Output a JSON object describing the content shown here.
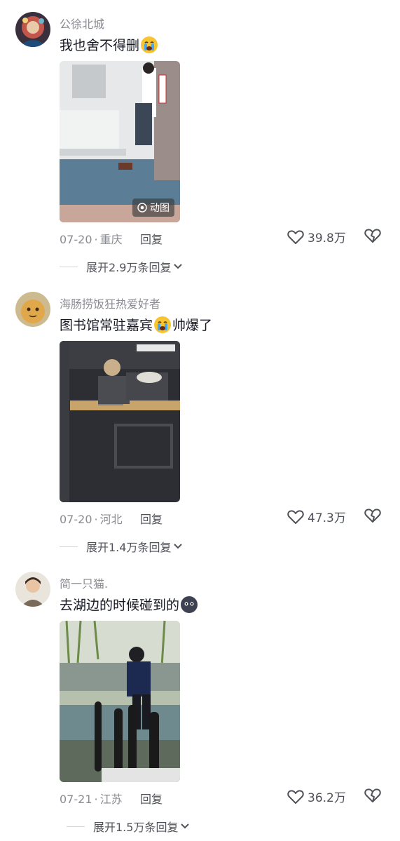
{
  "comments": [
    {
      "username": "公徐北城",
      "text_before": "我也舍不得删",
      "emoji": "crying-face-emoji",
      "text_after": "",
      "photo_badge": "动图",
      "date": "07-20",
      "location": "重庆",
      "reply_label": "回复",
      "likes": "39.8万",
      "expand_label": "展开2.9万条回复"
    },
    {
      "username": "海肠捞饭狂热爱好者",
      "text_before": "图书馆常驻嘉宾",
      "emoji": "crying-face-emoji",
      "text_after": "帅爆了",
      "photo_badge": "",
      "date": "07-20",
      "location": "河北",
      "reply_label": "回复",
      "likes": "47.3万",
      "expand_label": "展开1.4万条回复"
    },
    {
      "username": "简一只猫.",
      "text_before": "去湖边的时候碰到的",
      "emoji": "dark-face-emoji",
      "text_after": "",
      "photo_badge": "",
      "date": "07-21",
      "location": "江苏",
      "reply_label": "回复",
      "likes": "36.2万",
      "expand_label": "展开1.5万条回复"
    }
  ],
  "colors": {
    "secondary_text": "#8a8b91",
    "primary_text": "#161823",
    "action_text": "#505259"
  }
}
